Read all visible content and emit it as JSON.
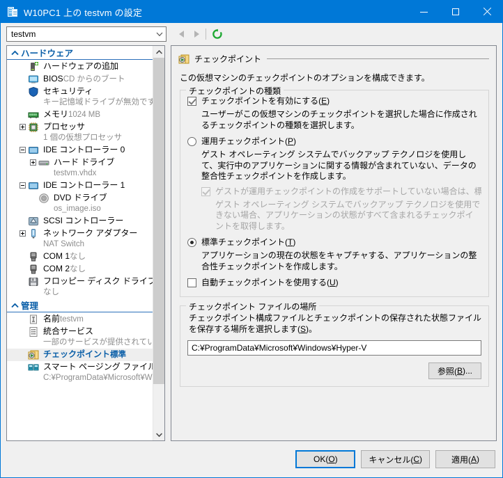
{
  "window": {
    "title": "W10PC1 上の testvm の設定",
    "title_icon": "vm-settings-icon",
    "minimize": "—",
    "maximize": "□",
    "close": "✕"
  },
  "toolbar": {
    "vm_selector_value": "testvm",
    "vm_selector_arrow": "chevron-down-icon",
    "back": "back-arrow-icon",
    "forward": "forward-arrow-icon",
    "refresh": "refresh-icon"
  },
  "sidebar": {
    "sections": [
      {
        "title": "ハードウェア",
        "chevron": "▲",
        "items": [
          {
            "label": "ハードウェアの追加",
            "sub": "",
            "icon": "add-hardware-icon",
            "expander": "",
            "indent": 1
          },
          {
            "label": "BIOS",
            "sub": "CD からのブート",
            "icon": "bios-icon",
            "expander": "",
            "indent": 1
          },
          {
            "label": "セキュリティ",
            "sub": "キー記憶域ドライブが無効です",
            "icon": "security-shield-icon",
            "expander": "",
            "indent": 1
          },
          {
            "label": "メモリ",
            "sub": "1024 MB",
            "icon": "memory-icon",
            "expander": "",
            "indent": 1
          },
          {
            "label": "プロセッサ",
            "sub": "1 個の仮想プロセッサ",
            "icon": "processor-icon",
            "expander": "plus",
            "indent": 1
          },
          {
            "label": "IDE コントローラー 0",
            "sub": "",
            "icon": "ide-controller-icon",
            "expander": "minus",
            "indent": 1
          },
          {
            "label": "ハード ドライブ",
            "sub": "testvm.vhdx",
            "icon": "hard-drive-icon",
            "expander": "plus",
            "indent": 2
          },
          {
            "label": "IDE コントローラー 1",
            "sub": "",
            "icon": "ide-controller-icon",
            "expander": "minus",
            "indent": 1
          },
          {
            "label": "DVD ドライブ",
            "sub": "os_image.iso",
            "icon": "dvd-drive-icon",
            "expander": "",
            "indent": 2
          },
          {
            "label": "SCSI コントローラー",
            "sub": "",
            "icon": "scsi-controller-icon",
            "expander": "",
            "indent": 1
          },
          {
            "label": "ネットワーク アダプター",
            "sub": "NAT Switch",
            "icon": "network-adapter-icon",
            "expander": "plus",
            "indent": 1
          },
          {
            "label": "COM 1",
            "sub": "なし",
            "icon": "com-port-icon",
            "expander": "",
            "indent": 1
          },
          {
            "label": "COM 2",
            "sub": "なし",
            "icon": "com-port-icon",
            "expander": "",
            "indent": 1
          },
          {
            "label": "フロッピー ディスク ドライブ",
            "sub": "なし",
            "icon": "floppy-drive-icon",
            "expander": "",
            "indent": 1
          }
        ]
      },
      {
        "title": "管理",
        "chevron": "▲",
        "items": [
          {
            "label": "名前",
            "sub": "testvm",
            "icon": "name-icon",
            "expander": "",
            "indent": 1
          },
          {
            "label": "統合サービス",
            "sub": "一部のサービスが提供されています",
            "icon": "integration-services-icon",
            "expander": "",
            "indent": 1
          },
          {
            "label": "チェックポイント",
            "sub": "標準",
            "icon": "checkpoint-icon",
            "expander": "",
            "indent": 1,
            "selected": true
          },
          {
            "label": "スマート ページング ファイルの場所",
            "sub": "C:¥ProgramData¥Microsoft¥Wi...",
            "icon": "smart-paging-icon",
            "expander": "",
            "indent": 1
          }
        ]
      }
    ],
    "scroll_up": "▲",
    "scroll_down": "▼"
  },
  "panel": {
    "icon": "checkpoint-icon",
    "title": "チェックポイント",
    "description": "この仮想マシンのチェックポイントのオプションを構成できます。",
    "type_group": {
      "title": "チェックポイントの種類",
      "enable_checkbox": {
        "label_pre": "チェックポイントを有効にする(",
        "accel": "E",
        "label_post": ")",
        "checked": true
      },
      "enable_help": "ユーザーがこの仮想マシンのチェックポイントを選択した場合に作成されるチェックポイントの種類を選択します。",
      "production_radio": {
        "label_pre": "運用チェックポイント(",
        "accel": "P",
        "label_post": ")",
        "selected": false
      },
      "production_help": "ゲスト オペレーティング システムでバックアップ テクノロジを使用して、実行中のアプリケーションに関する情報が含まれていない、データの整合性チェックポイントを作成します。",
      "fallback_checkbox": {
        "label": "ゲストが運用チェックポイントの作成をサポートしていない場合は、標準チェックポイ",
        "checked": true,
        "disabled": true
      },
      "fallback_help": "ゲスト オペレーティング システムでバックアップ テクノロジを使用できない場合、アプリケーションの状態がすべて含まれるチェックポイントを取得します。",
      "standard_radio": {
        "label_pre": "標準チェックポイント(",
        "accel": "T",
        "label_post": ")",
        "selected": true
      },
      "standard_help": "アプリケーションの現在の状態をキャプチャする、アプリケーションの整合性チェックポイントを作成します。",
      "auto_checkbox": {
        "label_pre": "自動チェックポイントを使用する(",
        "accel": "U",
        "label_post": ")",
        "checked": false
      }
    },
    "location_group": {
      "title": "チェックポイント ファイルの場所",
      "description_pre": "チェックポイント構成ファイルとチェックポイントの保存された状態ファイルを保存する場所を選択します(",
      "description_accel": "S",
      "description_post": ")。",
      "path_value": "C:¥ProgramData¥Microsoft¥Windows¥Hyper-V",
      "browse_pre": "参照(",
      "browse_accel": "B",
      "browse_post": ")..."
    }
  },
  "footer": {
    "ok_pre": "OK(",
    "ok_accel": "O",
    "ok_post": ")",
    "cancel_pre": "キャンセル(",
    "cancel_accel": "C",
    "cancel_post": ")",
    "apply_pre": "適用(",
    "apply_accel": "A",
    "apply_post": ")"
  }
}
